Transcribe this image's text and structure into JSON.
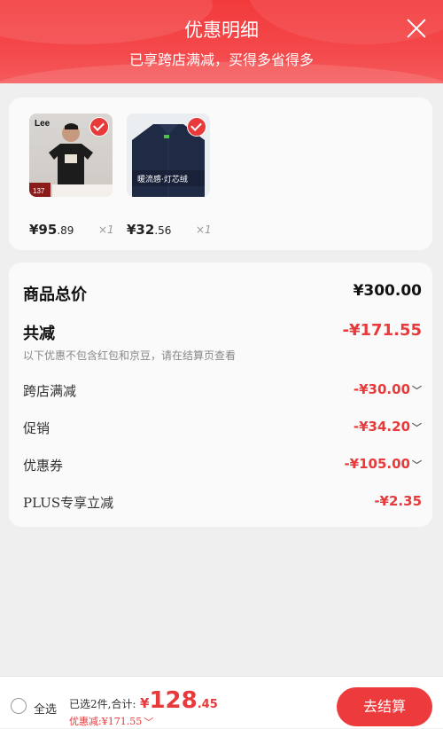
{
  "header": {
    "title": "优惠明细",
    "subtitle": "已享跨店满减，买得多省得多"
  },
  "products": [
    {
      "brand": "Lee",
      "tag": "137",
      "price_int": "¥95",
      "price_dec": ".89",
      "qty": "×1"
    },
    {
      "badge": "暖流感·灯芯绒",
      "price_int": "¥32",
      "price_dec": ".56",
      "qty": "×1"
    }
  ],
  "summary": {
    "total_label": "商品总价",
    "total_value": "¥300.00",
    "discount_label": "共减",
    "discount_value": "-¥171.55",
    "note": "以下优惠不包含红包和京豆，请在结算页查看",
    "items": [
      {
        "label": "跨店满减",
        "value": "-¥30.00"
      },
      {
        "label": "促销",
        "value": "-¥34.20"
      },
      {
        "label": "优惠券",
        "value": "-¥105.00"
      },
      {
        "label": "PLUS专享立减",
        "value": "-¥2.35"
      }
    ]
  },
  "footer": {
    "select_all": "全选",
    "selected_info": "已选2件,合计:",
    "total_sym": "¥",
    "total_int": "128",
    "total_dec": ".45",
    "discount_text": "优惠减:¥171.55",
    "checkout": "去结算"
  },
  "colors": {
    "accent": "#e8393b",
    "header": "#f23a3c"
  },
  "icons": [
    "close-icon",
    "check-icon",
    "chevron-down-icon",
    "radio-icon"
  ]
}
